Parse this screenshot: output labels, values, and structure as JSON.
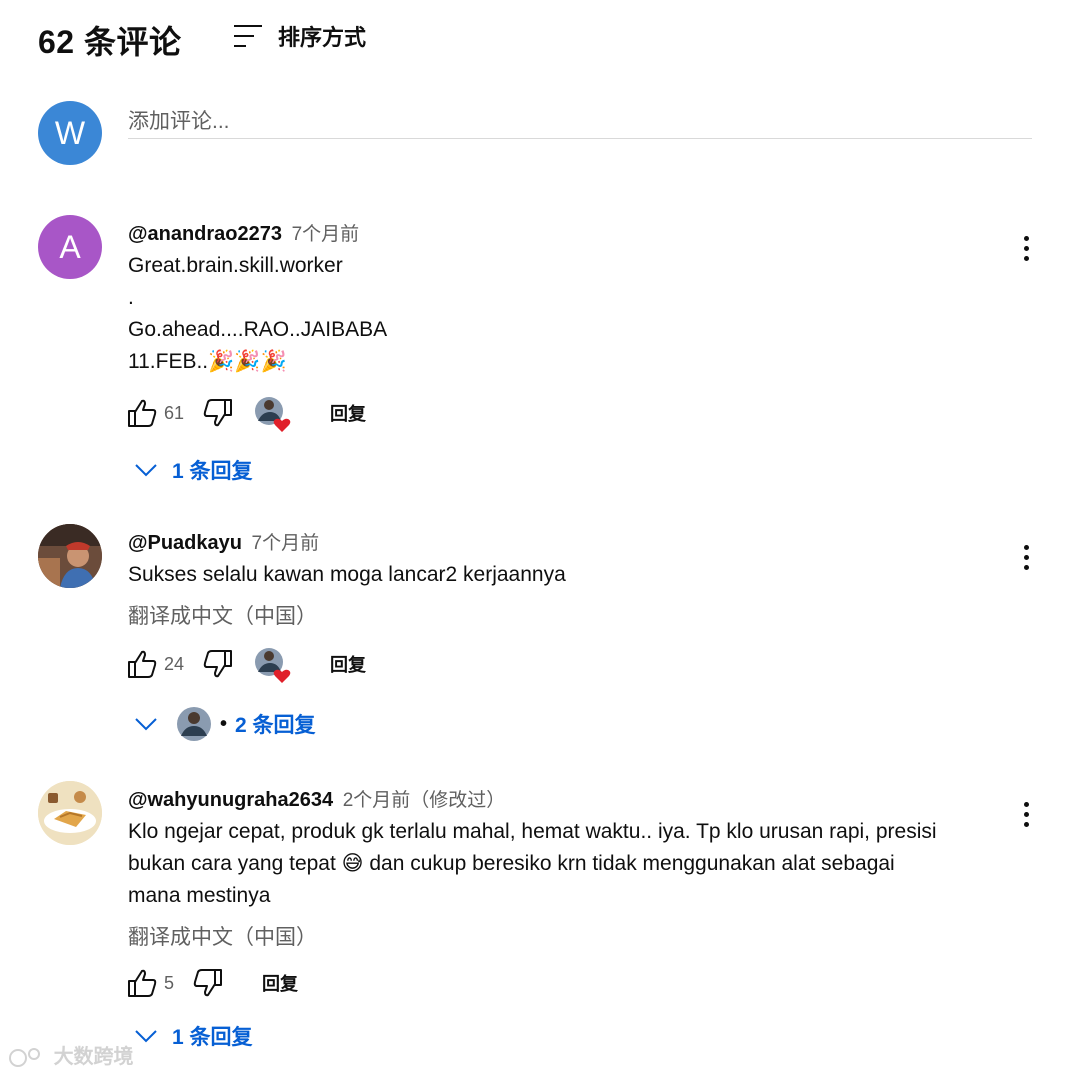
{
  "header": {
    "count_label": "62 条评论",
    "sort_label": "排序方式"
  },
  "add_comment": {
    "avatar_letter": "W",
    "avatar_color": "#3b87d6",
    "placeholder": "添加评论..."
  },
  "comments": [
    {
      "avatar_letter": "A",
      "avatar_color": "#a856c7",
      "author": "@anandrao2273",
      "time": "7个月前",
      "text_lines": [
        "Great.brain.skill.worker",
        ".",
        "Go.ahead....RAO..JAIBABA",
        "11.FEB..🎉🎉🎉"
      ],
      "likes": "61",
      "reply_label": "回复",
      "replies_label": "1 条回复"
    },
    {
      "author": "@Puadkayu",
      "time": "7个月前",
      "text_lines": [
        "Sukses selalu kawan moga lancar2 kerjaannya"
      ],
      "translate_label": "翻译成中文（中国）",
      "likes": "24",
      "reply_label": "回复",
      "replies_label": "2 条回复"
    },
    {
      "author": "@wahyunugraha2634",
      "time": "2个月前（修改过）",
      "text_lines": [
        "Klo ngejar cepat, produk gk terlalu mahal, hemat waktu.. iya. Tp klo urusan rapi, presisi",
        "bukan cara yang tepat 😅  dan cukup beresiko krn tidak menggunakan alat sebagai",
        "mana mestinya"
      ],
      "translate_label": "翻译成中文（中国）",
      "likes": "5",
      "reply_label": "回复",
      "replies_label": "1 条回复"
    }
  ],
  "watermark": "大数跨境",
  "colors": {
    "link_blue": "#065fd4",
    "secondary_text": "#606060",
    "heart_red": "#e0202a"
  }
}
